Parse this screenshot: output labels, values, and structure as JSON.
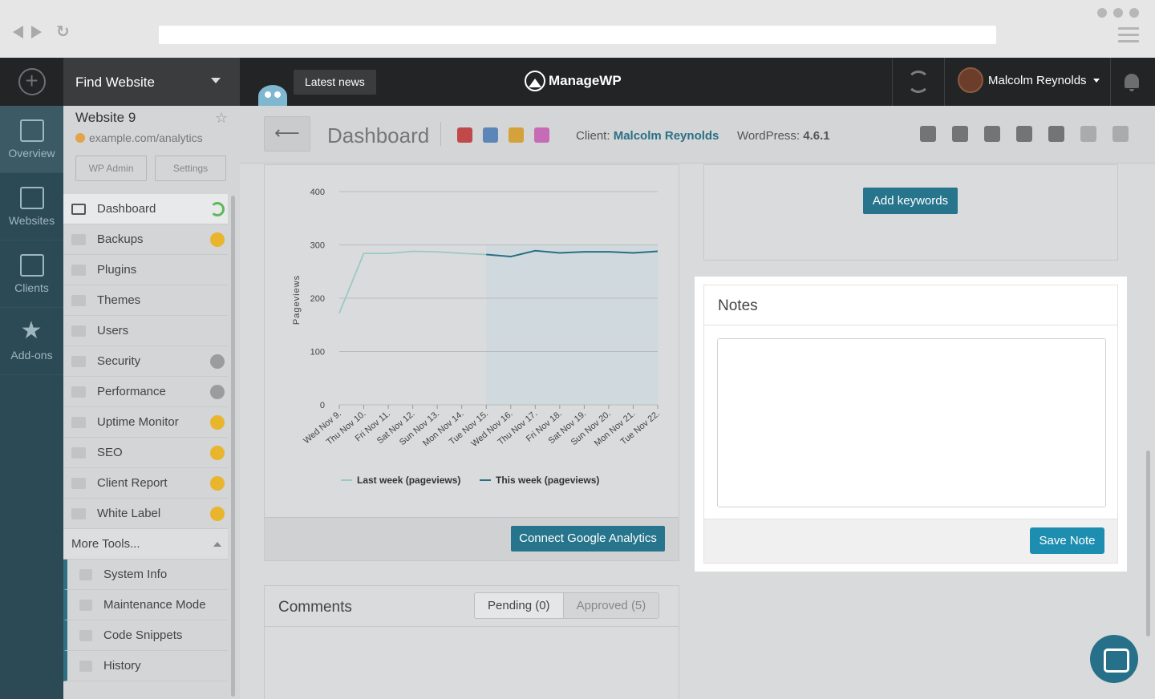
{
  "header": {
    "find_website": "Find Website",
    "latest_news": "Latest news",
    "logo_text": "ManageWP",
    "user_name": "Malcolm Reynolds"
  },
  "rail": [
    {
      "label": "Overview",
      "icon": "overview-icon"
    },
    {
      "label": "Websites",
      "icon": "websites-icon"
    },
    {
      "label": "Clients",
      "icon": "clients-icon"
    },
    {
      "label": "Add-ons",
      "icon": "addons-icon"
    }
  ],
  "site": {
    "name": "Website 9",
    "url": "example.com/analytics",
    "wp_admin": "WP Admin",
    "settings": "Settings"
  },
  "menu": [
    {
      "label": "Dashboard",
      "badge": "refresh"
    },
    {
      "label": "Backups",
      "badge": "gold"
    },
    {
      "label": "Plugins",
      "badge": ""
    },
    {
      "label": "Themes",
      "badge": ""
    },
    {
      "label": "Users",
      "badge": ""
    },
    {
      "label": "Security",
      "badge": "gray"
    },
    {
      "label": "Performance",
      "badge": "gray"
    },
    {
      "label": "Uptime Monitor",
      "badge": "gold"
    },
    {
      "label": "SEO",
      "badge": "gold"
    },
    {
      "label": "Client Report",
      "badge": "gold"
    },
    {
      "label": "White Label",
      "badge": "gold"
    }
  ],
  "more_tools": {
    "label": "More Tools...",
    "items": [
      "System Info",
      "Maintenance Mode",
      "Code Snippets",
      "History"
    ]
  },
  "dashboard": {
    "title": "Dashboard",
    "swatches": [
      "#c2494a",
      "#5b86b7",
      "#d4a13a",
      "#c66cb6"
    ],
    "client_label": "Client:",
    "client_name": "Malcolm Reynolds",
    "wp_label": "WordPress:",
    "wp_version": "4.6.1"
  },
  "chart_panel": {
    "connect_label": "Connect Google Analytics"
  },
  "keywords": {
    "add_label": "Add keywords"
  },
  "notes": {
    "title": "Notes",
    "text_value": "",
    "save_label": "Save Note"
  },
  "comments": {
    "title": "Comments",
    "pending": "Pending (0)",
    "approved": "Approved (5)"
  },
  "chart_data": {
    "type": "line",
    "x": [
      "Wed Nov 9.",
      "Thu Nov 10.",
      "Fri Nov 11.",
      "Sat Nov 12.",
      "Sun Nov 13.",
      "Mon Nov 14.",
      "Tue Nov 15.",
      "Wed Nov 16.",
      "Thu Nov 17.",
      "Fri Nov 18.",
      "Sat Nov 19.",
      "Sun Nov 20.",
      "Mon Nov 21.",
      "Tue Nov 22."
    ],
    "series": [
      {
        "name": "Last week (pageviews)",
        "color": "#9cc9c2",
        "values": [
          172,
          284,
          284,
          288,
          287,
          284,
          282,
          null,
          null,
          null,
          null,
          null,
          null,
          null
        ]
      },
      {
        "name": "This week (pageviews)",
        "color": "#2a6f84",
        "values": [
          null,
          null,
          null,
          null,
          null,
          null,
          282,
          278,
          289,
          285,
          287,
          287,
          285,
          288
        ]
      }
    ],
    "ylabel": "Pageviews",
    "ylim": [
      0,
      400
    ],
    "yticks": [
      0,
      100,
      200,
      300,
      400
    ],
    "legend": "bottom"
  }
}
